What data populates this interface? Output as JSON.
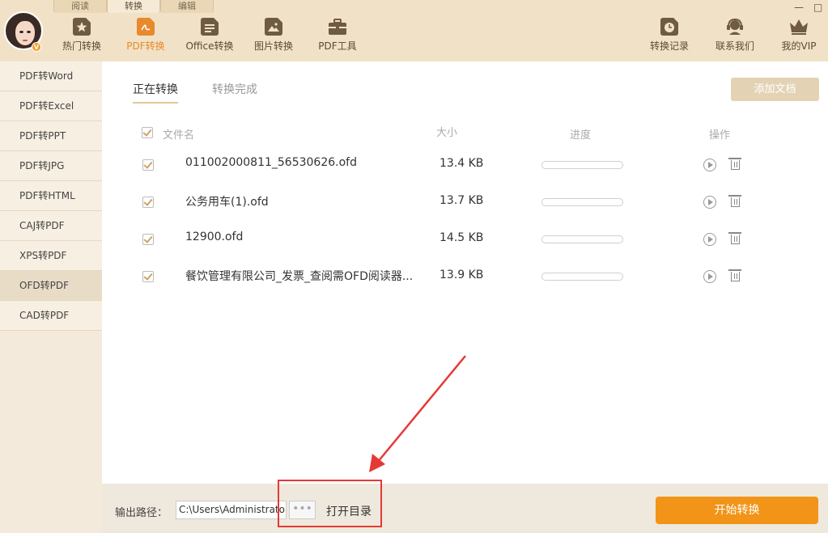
{
  "top_tabs": [
    "阅读",
    "转换",
    "编辑"
  ],
  "window_controls": [
    "—",
    "□"
  ],
  "nav": [
    {
      "label": "热门转换",
      "icon": "star-doc-icon"
    },
    {
      "label": "PDF转换",
      "icon": "pdf-doc-icon"
    },
    {
      "label": "Office转换",
      "icon": "office-doc-icon"
    },
    {
      "label": "图片转换",
      "icon": "image-doc-icon"
    },
    {
      "label": "PDF工具",
      "icon": "toolbox-icon"
    }
  ],
  "right_nav": [
    {
      "label": "转换记录",
      "icon": "clock-icon"
    },
    {
      "label": "联系我们",
      "icon": "headset-icon"
    },
    {
      "label": "我的VIP",
      "icon": "crown-icon"
    }
  ],
  "vip_badge": "V",
  "sidebar": [
    "PDF转Word",
    "PDF转Excel",
    "PDF转PPT",
    "PDF转JPG",
    "PDF转HTML",
    "CAJ转PDF",
    "XPS转PDF",
    "OFD转PDF",
    "CAD转PDF"
  ],
  "sidebar_active_index": 7,
  "subtabs": [
    "正在转换",
    "转换完成"
  ],
  "add_button": "添加文档",
  "table": {
    "headers": {
      "name": "文件名",
      "size": "大小",
      "progress": "进度",
      "action": "操作"
    },
    "rows": [
      {
        "name": "011002000811_56530626.ofd",
        "size": "13.4 KB",
        "progress": 0
      },
      {
        "name": "公务用车(1).ofd",
        "size": "13.7 KB",
        "progress": 0
      },
      {
        "name": "12900.ofd",
        "size": "14.5 KB",
        "progress": 0
      },
      {
        "name": "餐饮管理有限公司_发票_查阅需OFD阅读器...",
        "size": "13.9 KB",
        "progress": 0
      }
    ]
  },
  "bottom": {
    "path_label": "输出路径：",
    "path_value": "C:\\Users\\Administrator\\",
    "dots": "•••",
    "open_dir": "打开目录",
    "start": "开始转换"
  },
  "colors": {
    "accent": "#e8892b",
    "start_button": "#f29418",
    "annotation": "#e53935"
  }
}
